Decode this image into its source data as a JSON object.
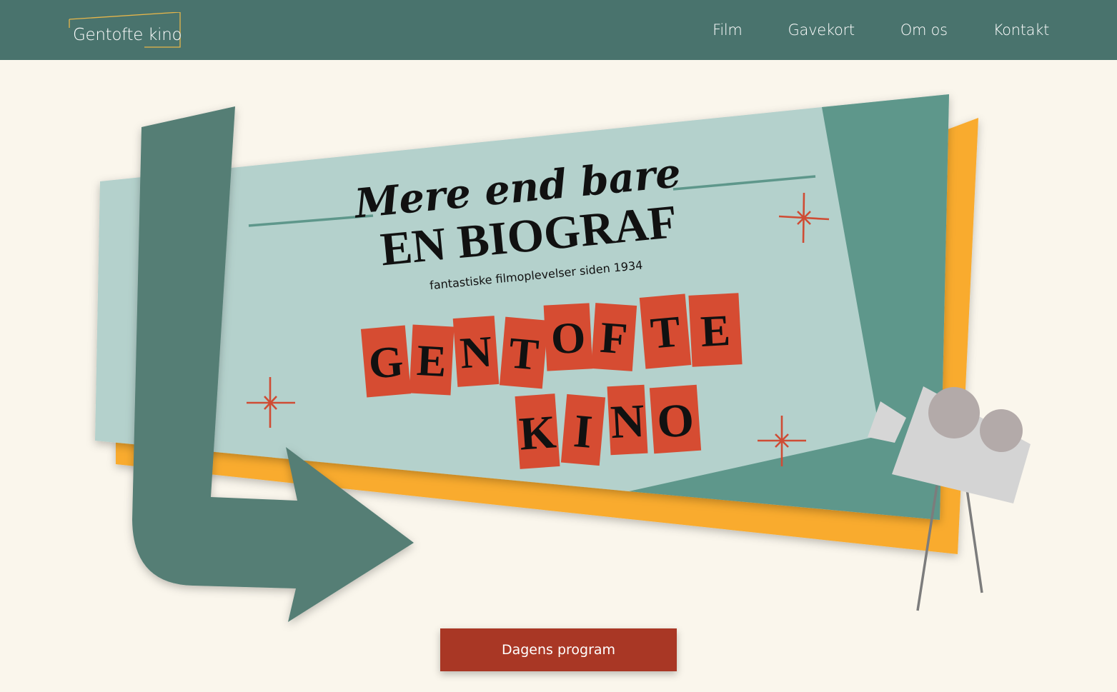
{
  "header": {
    "logo_text": "Gentofte kino",
    "nav": [
      "Film",
      "Gavekort",
      "Om os",
      "Kontakt"
    ]
  },
  "hero": {
    "script_line": "Mere end bare",
    "headline": "EN BIOGRAF",
    "tagline": "fantastiske filmoplevelser siden 1934",
    "sign_line_1": [
      "G",
      "E",
      "N",
      "T",
      "O",
      "F",
      "T",
      "E"
    ],
    "sign_line_2": [
      "K",
      "I",
      "N",
      "O"
    ]
  },
  "cta": {
    "label": "Dagens program"
  },
  "colors": {
    "header_bg": "#49736d",
    "page_bg": "#faf6ec",
    "ticket_light": "#b4d1cc",
    "ticket_dark": "#5e978b",
    "arrow": "#557e75",
    "accent_yellow": "#f9ab2e",
    "letter_tile": "#d64c32",
    "sparkle": "#cf4c34",
    "button": "#a93725"
  },
  "icons": [
    "sparkle-icon",
    "film-camera-icon",
    "arrow-graphic"
  ]
}
